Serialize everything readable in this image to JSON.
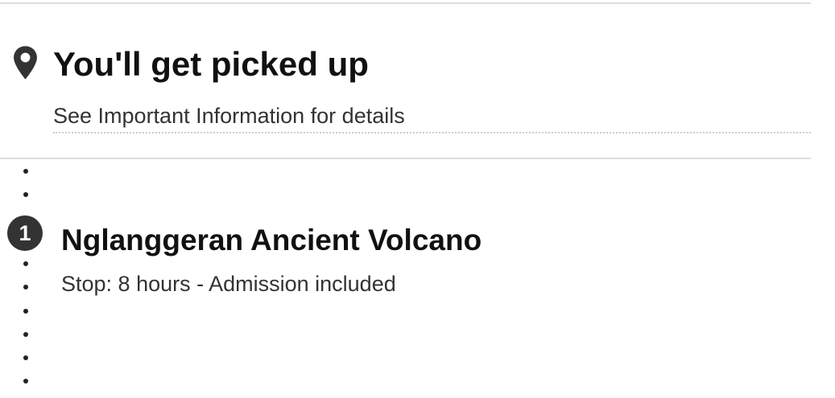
{
  "pickup": {
    "title": "You'll get picked up",
    "subtitle": "See Important Information for details",
    "icon": "map-pin-icon"
  },
  "stop": {
    "number": "1",
    "title": "Nglanggeran Ancient Volcano",
    "detail": "Stop: 8 hours - Admission included"
  },
  "colors": {
    "text": "#111111",
    "muted": "#333333",
    "badge": "#333333",
    "divider": "#dddddd"
  }
}
